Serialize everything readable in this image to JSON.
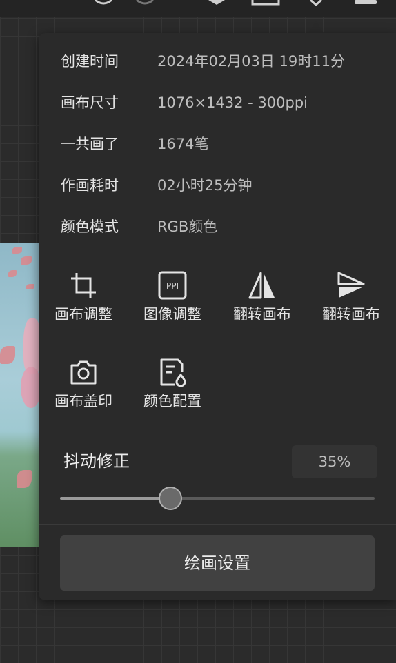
{
  "info": {
    "created_label": "创建时间",
    "created_value": "2024年02月03日 19时11分",
    "canvas_size_label": "画布尺寸",
    "canvas_size_value": "1076×1432 - 300ppi",
    "strokes_label": "一共画了",
    "strokes_value": "1674笔",
    "time_label": "作画耗时",
    "time_value": "02小时25分钟",
    "color_mode_label": "颜色模式",
    "color_mode_value": "RGB颜色"
  },
  "tools": [
    {
      "label": "画布调整",
      "icon": "crop-icon"
    },
    {
      "label": "图像调整",
      "icon": "ppi-icon"
    },
    {
      "label": "翻转画布",
      "icon": "flip-horizontal-icon"
    },
    {
      "label": "翻转画布",
      "icon": "flip-vertical-icon"
    },
    {
      "label": "画布盖印",
      "icon": "camera-icon"
    },
    {
      "label": "颜色配置",
      "icon": "color-profile-icon"
    }
  ],
  "ppi_badge_text": "PPI",
  "stabilizer": {
    "label": "抖动修正",
    "value_text": "35%",
    "value": 0.35
  },
  "settings_button": "绘画设置",
  "colors": {
    "panel_bg": "#2a2a2a",
    "button_bg": "#414141",
    "text_primary": "#e4e4e4",
    "text_secondary": "#bdbdbd"
  }
}
